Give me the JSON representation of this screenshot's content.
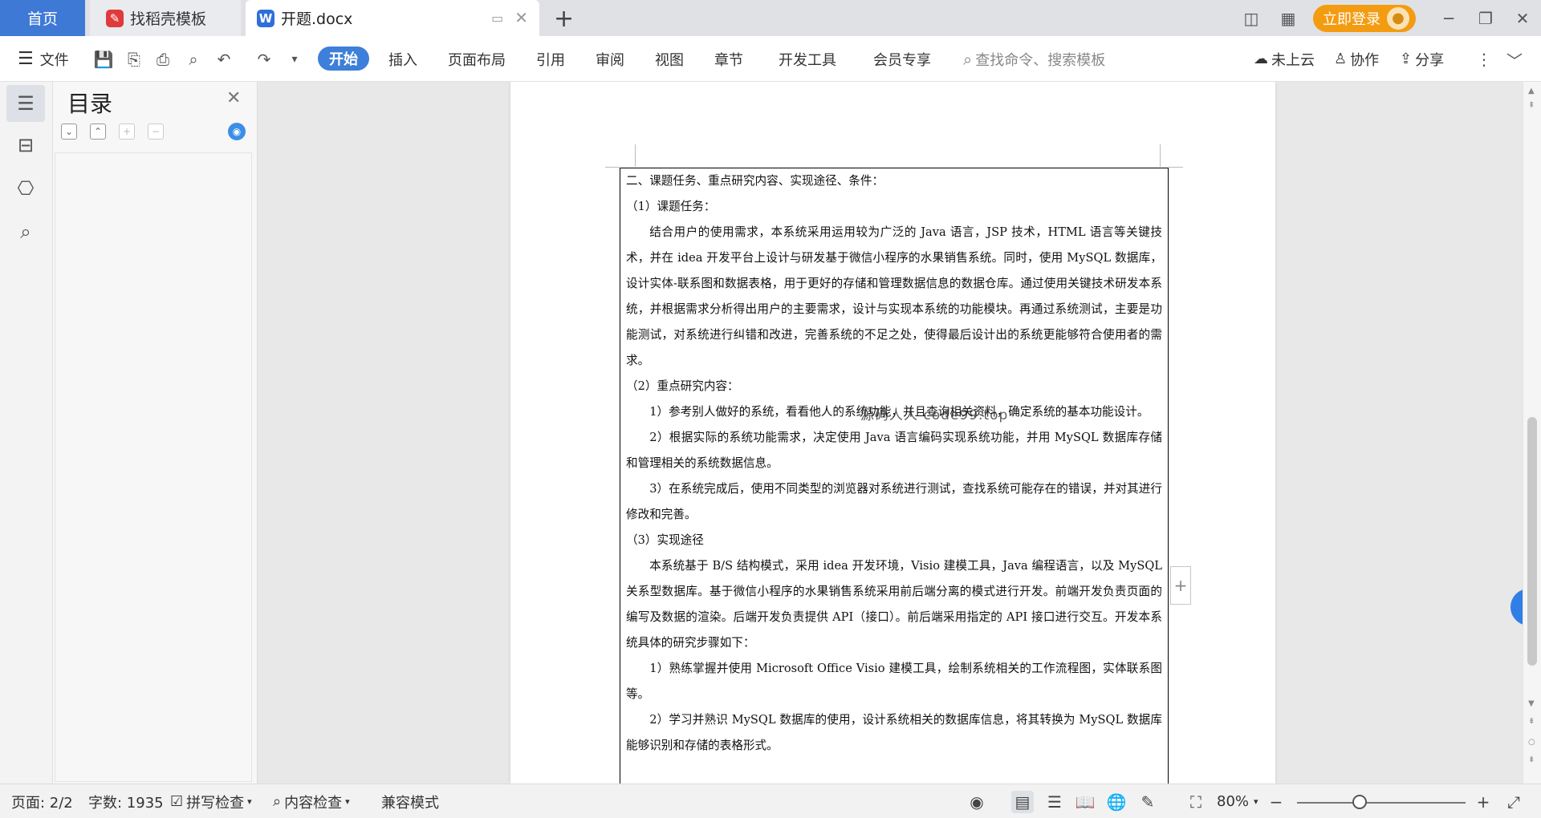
{
  "tabs": {
    "home": "首页",
    "template": "找稻壳模板",
    "doc": "开题.docx",
    "new_tab": "+"
  },
  "window": {
    "login": "立即登录"
  },
  "ribbon": {
    "file": "文件",
    "menus": [
      "开始",
      "插入",
      "页面布局",
      "引用",
      "审阅",
      "视图",
      "章节",
      "开发工具",
      "会员专享"
    ],
    "search_placeholder": "查找命令、搜索模板",
    "cloud": "未上云",
    "collab": "协作",
    "share": "分享"
  },
  "toc": {
    "title": "目录"
  },
  "document": {
    "paragraphs": [
      "二、课题任务、重点研究内容、实现途径、条件：",
      "（1）课题任务：",
      "结合用户的使用需求，本系统采用运用较为广泛的 Java 语言，JSP 技术，HTML 语言等关键技术，并在 idea 开发平台上设计与研发基于微信小程序的水果销售系统。同时，使用 MySQL 数据库，设计实体-联系图和数据表格，用于更好的存储和管理数据信息的数据仓库。通过使用关键技术研发本系统，并根据需求分析得出用户的主要需求，设计与实现本系统的功能模块。再通过系统测试，主要是功能测试，对系统进行纠错和改进，完善系统的不足之处，使得最后设计出的系统更能够符合使用者的需求。",
      "（2）重点研究内容：",
      "1）参考别人做好的系统，看看他人的系统功能，并且查询相关资料，确定系统的基本功能设计。",
      "2）根据实际的系统功能需求，决定使用 Java 语言编码实现系统功能，并用 MySQL 数据库存储和管理相关的系统数据信息。",
      "3）在系统完成后，使用不同类型的浏览器对系统进行测试，查找系统可能存在的错误，并对其进行修改和完善。",
      "（3）实现途径",
      "本系统基于 B/S 结构模式，采用 idea 开发环境，Visio 建模工具，Java 编程语言，以及 MySQL 关系型数据库。基于微信小程序的水果销售系统采用前后端分离的模式进行开发。前端开发负责页面的编写及数据的渲染。后端开发负责提供 API（接口）。前后端采用指定的 API 接口进行交互。开发本系统具体的研究步骤如下：",
      "1）熟练掌握并使用 Microsoft Office Visio 建模工具，绘制系统相关的工作流程图，实体联系图等。",
      "2）学习并熟识 MySQL 数据库的使用，设计系统相关的数据库信息，将其转换为 MySQL 数据库能够识别和存储的表格形式。"
    ],
    "watermark": "源码人人 code99.top"
  },
  "statusbar": {
    "page": "页面: 2/2",
    "words": "字数: 1935",
    "spell": "拼写检查",
    "content_check": "内容检查",
    "compat": "兼容模式",
    "zoom": "80%"
  },
  "colors": {
    "accent": "#3d7fd9",
    "home_tab": "#3f79d6",
    "login": "#f39c12"
  }
}
